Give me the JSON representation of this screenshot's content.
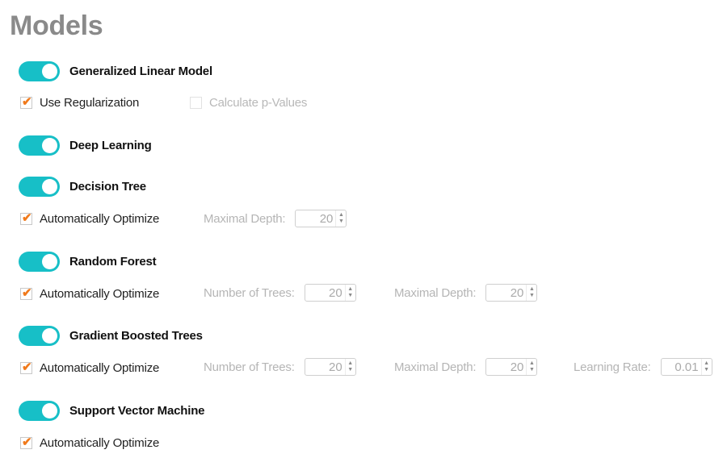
{
  "page": {
    "title": "Models"
  },
  "colors": {
    "toggle_on": "#17bfc7",
    "checkmark": "#f07a1c",
    "title": "#8a8a8a"
  },
  "models": {
    "glm": {
      "name": "Generalized Linear Model",
      "enabled": true,
      "options": [
        {
          "label": "Use Regularization",
          "checked": true,
          "disabled": false
        },
        {
          "label": "Calculate p-Values",
          "checked": false,
          "disabled": true
        }
      ]
    },
    "dl": {
      "name": "Deep Learning",
      "enabled": true
    },
    "dt": {
      "name": "Decision Tree",
      "enabled": true,
      "auto_optimize": {
        "label": "Automatically Optimize",
        "checked": true
      },
      "params": [
        {
          "label": "Maximal Depth:",
          "value": "20"
        }
      ]
    },
    "rf": {
      "name": "Random Forest",
      "enabled": true,
      "auto_optimize": {
        "label": "Automatically Optimize",
        "checked": true
      },
      "params": [
        {
          "label": "Number of Trees:",
          "value": "20"
        },
        {
          "label": "Maximal Depth:",
          "value": "20"
        }
      ]
    },
    "gbt": {
      "name": "Gradient Boosted Trees",
      "enabled": true,
      "auto_optimize": {
        "label": "Automatically Optimize",
        "checked": true
      },
      "params": [
        {
          "label": "Number of Trees:",
          "value": "20"
        },
        {
          "label": "Maximal Depth:",
          "value": "20"
        },
        {
          "label": "Learning Rate:",
          "value": "0.01"
        }
      ]
    },
    "svm": {
      "name": "Support Vector Machine",
      "enabled": true,
      "auto_optimize": {
        "label": "Automatically Optimize",
        "checked": true
      }
    }
  },
  "icons": {
    "check": "✔",
    "spin_up": "▲",
    "spin_down": "▼"
  }
}
